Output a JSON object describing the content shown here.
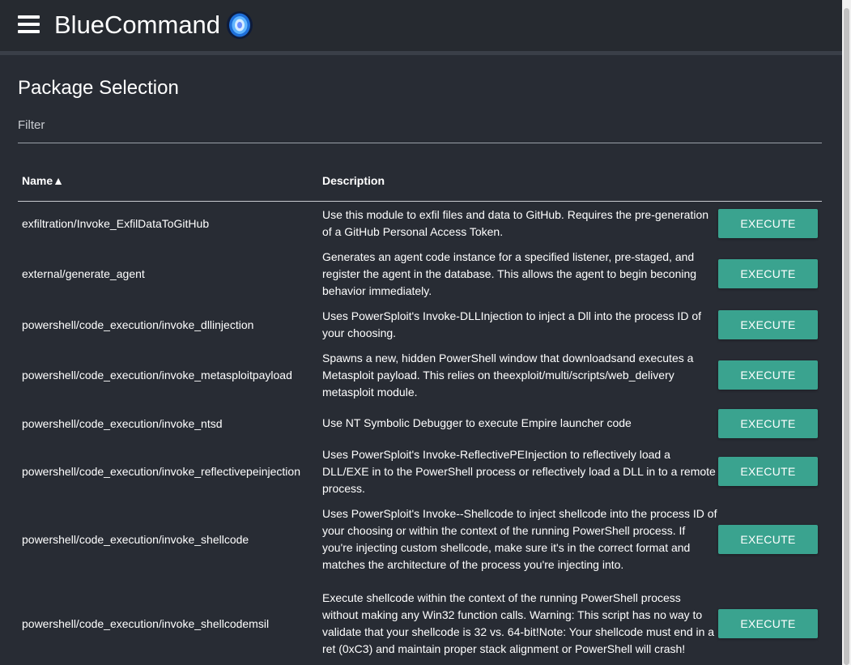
{
  "app": {
    "title": "BlueCommand",
    "menu_icon": "hamburger-menu-icon",
    "logo_icon": "portal-logo-icon",
    "colors": {
      "background": "#282c34",
      "appbar": "#262a30",
      "accent": "#3aa38f"
    }
  },
  "page": {
    "title": "Package Selection",
    "filter": {
      "label": "Filter",
      "value": ""
    }
  },
  "table": {
    "columns": {
      "name": "Name▲",
      "description": "Description"
    },
    "action_label": "EXECUTE",
    "rows": [
      {
        "name": "exfiltration/Invoke_ExfilDataToGitHub",
        "description": "Use this module to exfil files and data to GitHub. Requires the pre-generation of a GitHub Personal Access Token."
      },
      {
        "name": "external/generate_agent",
        "description": "Generates an agent code instance for a specified listener, pre-staged, and register the agent in the database. This allows the agent to begin beconing behavior immediately."
      },
      {
        "name": "powershell/code_execution/invoke_dllinjection",
        "description": "Uses PowerSploit's Invoke-DLLInjection to inject a Dll into the process ID of your choosing."
      },
      {
        "name": "powershell/code_execution/invoke_metasploitpayload",
        "description": "Spawns a new, hidden PowerShell window that downloadsand executes a Metasploit payload. This relies on theexploit/multi/scripts/web_delivery metasploit module."
      },
      {
        "name": "powershell/code_execution/invoke_ntsd",
        "description": "Use NT Symbolic Debugger to execute Empire launcher code"
      },
      {
        "name": "powershell/code_execution/invoke_reflectivepeinjection",
        "description": "Uses PowerSploit's Invoke-ReflectivePEInjection to reflectively load a DLL/EXE in to the PowerShell process or reflectively load a DLL in to a remote process."
      },
      {
        "name": "powershell/code_execution/invoke_shellcode",
        "description": "Uses PowerSploit's Invoke--Shellcode to inject shellcode into the process ID of your choosing or within the context of the running PowerShell process. If you're injecting custom shellcode, make sure it's in the correct format and matches the architecture of the process you're injecting into."
      },
      {
        "name": "powershell/code_execution/invoke_shellcodemsil",
        "description": "Execute shellcode within the context of the running PowerShell process without making any Win32 function calls. Warning: This script has no way to validate that your shellcode is 32 vs. 64-bit!Note: Your shellcode must end in a ret (0xC3) and maintain proper stack alignment or PowerShell will crash!"
      }
    ]
  }
}
